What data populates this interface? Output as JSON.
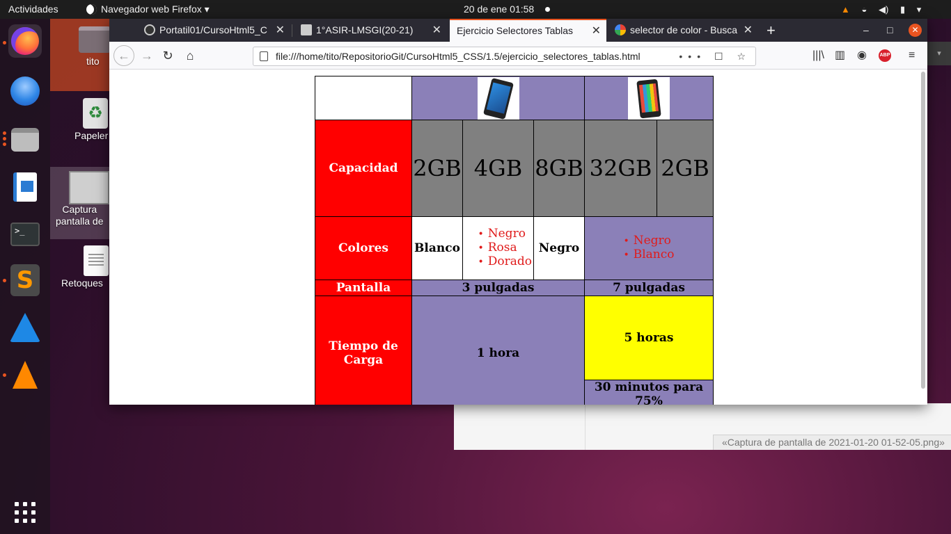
{
  "topbar": {
    "activities": "Actividades",
    "app_name": "Navegador web Firefox",
    "app_menu_arrow": "▾",
    "clock": "20 de ene  01:58"
  },
  "dock": {
    "apps": [
      "firefox-icon",
      "thunderbird-icon",
      "files-icon",
      "libreoffice-writer-icon",
      "terminal-icon",
      "sublime-text-icon",
      "wireshark-icon",
      "vlc-icon",
      "show-apps-icon"
    ],
    "terminal_glyph": ">_",
    "sublime_glyph": "S"
  },
  "desktop": {
    "icons": [
      {
        "label": "tito"
      },
      {
        "label": "Papeler"
      },
      {
        "label": "Captura\npantalla de"
      },
      {
        "label": "Retoques"
      }
    ]
  },
  "viewer": {
    "status": "«Captura de pantalla de 2021-01-20 01-52-05.png»"
  },
  "browser": {
    "tabs": [
      {
        "label": "Portatil01/CursoHtml5_C",
        "close": "✕"
      },
      {
        "label": "1°ASIR-LMSGI(20-21)",
        "close": "✕"
      },
      {
        "label": "Ejercicio Selectores Tablas",
        "close": "✕"
      },
      {
        "label": "selector de color - Busca",
        "close": "✕"
      }
    ],
    "new_tab": "+",
    "url": "file:///home/tito/RepositorioGit/CursoHtml5_CSS/1.5/ejercicio_selectores_tablas.html",
    "url_actions": "••• ☐ ☆"
  },
  "page": {
    "rows": {
      "capacidad": {
        "header": "Capacidad",
        "values": [
          "2GB",
          "4GB",
          "8GB",
          "32GB",
          "2GB"
        ]
      },
      "colores": {
        "header": "Colores",
        "cell1": "Blanco",
        "list1": [
          "Negro",
          "Rosa",
          "Dorado"
        ],
        "cell3": "Negro",
        "list2": [
          "Negro",
          "Blanco"
        ]
      },
      "pantalla": {
        "header": "Pantalla",
        "phone1": "3 pulgadas",
        "phone2": "7 pulgadas"
      },
      "tiempo": {
        "header": "Tiempo de Carga",
        "phone1": "1 hora",
        "phone2_top": "5 horas",
        "phone2_bottom": "30 minutos para 75%"
      }
    },
    "colors": {
      "header_red": "#ff0000",
      "purple": "#8b80b8",
      "grey": "#808080",
      "yellow": "#ffff00",
      "list_red": "#e01b1b"
    }
  }
}
